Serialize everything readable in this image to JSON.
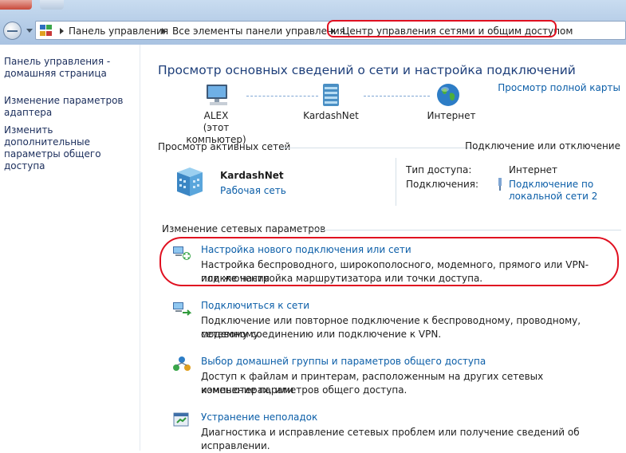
{
  "breadcrumb": [
    "Панель управления",
    "Все элементы панели управления",
    "Центр управления сетями и общим доступом"
  ],
  "left_pane": [
    "Панель управления - домашняя страница",
    "Изменение параметров адаптера",
    "Изменить дополнительные параметры общего доступа"
  ],
  "main": {
    "title": "Просмотр основных сведений о сети и настройка подключений",
    "full_map_link": "Просмотр полной карты",
    "map": {
      "computer": "ALEX",
      "computer_sub": "(этот компьютер)",
      "network": "KardashNet",
      "internet": "Интернет"
    },
    "active_title": "Просмотр активных сетей",
    "connect_link": "Подключение или отключение",
    "active": {
      "name": "KardashNet",
      "type": "Рабочая сеть",
      "access_label": "Тип доступа:",
      "access_value": "Интернет",
      "conn_label": "Подключения:",
      "conn_value_1": "Подключение по",
      "conn_value_2": "локальной сети 2"
    },
    "change_title": "Изменение сетевых параметров",
    "tasks": [
      {
        "title": "Настройка нового подключения или сети",
        "desc1": "Настройка беспроводного, широкополосного, модемного, прямого или VPN-подключения",
        "desc2": "или же настройка маршрутизатора или точки доступа."
      },
      {
        "title": "Подключиться к сети",
        "desc1": "Подключение или повторное подключение к беспроводному, проводному, модемному",
        "desc2": "сетевому соединению или подключение к VPN."
      },
      {
        "title": "Выбор домашней группы и параметров общего доступа",
        "desc1": "Доступ к файлам и принтерам, расположенным на других сетевых компьютерах, или",
        "desc2": "изменение параметров общего доступа."
      },
      {
        "title": "Устранение неполадок",
        "desc1": "Диагностика и исправление сетевых проблем или получение сведений об исправлении."
      }
    ]
  },
  "colors": {
    "link": "#0b5ea8",
    "heading": "#1e3f7a",
    "annotation": "#e01020"
  }
}
